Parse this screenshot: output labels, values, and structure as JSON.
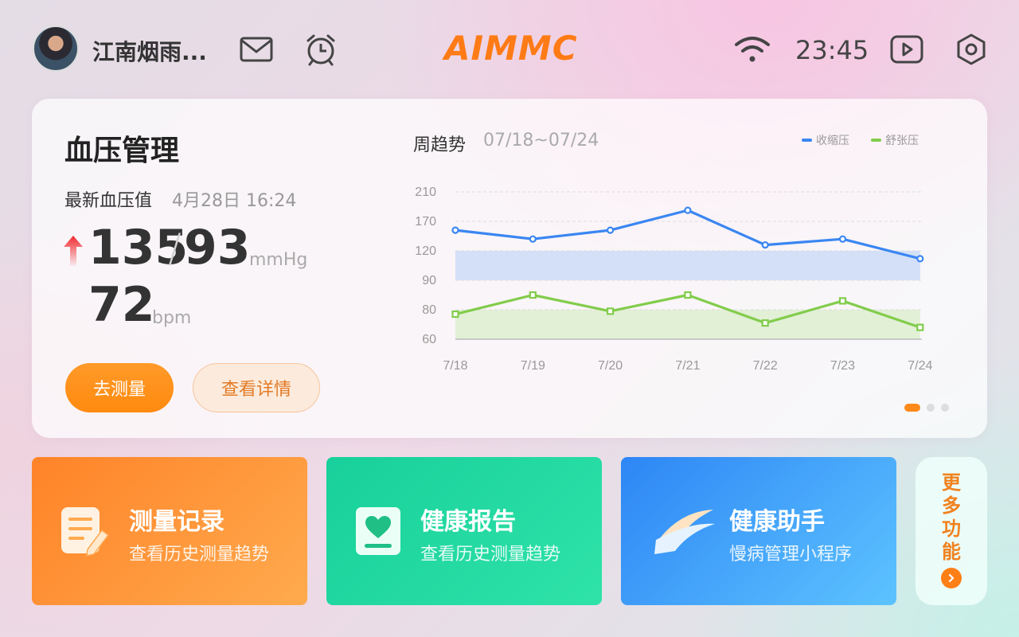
{
  "header": {
    "username": "江南烟雨...",
    "logo": "AIMMC",
    "time": "23:45",
    "icons": [
      "avatar",
      "mail-icon",
      "alarm-icon",
      "wifi-icon",
      "video-icon",
      "settings-icon"
    ]
  },
  "bp_card": {
    "title": "血压管理",
    "latest_label": "最新血压值",
    "latest_time": "4月28日 16:24",
    "systolic": "135",
    "slash": "/",
    "diastolic": "93",
    "bp_unit": "mmHg",
    "pulse": "72",
    "pulse_unit": "bpm",
    "measure_button": "去测量",
    "detail_button": "查看详情",
    "trend_title": "周趋势",
    "trend_range": "07/18~07/24",
    "carousel_pages": 3,
    "carousel_active": 0
  },
  "chart_data": {
    "type": "line",
    "categories": [
      "7/18",
      "7/19",
      "7/20",
      "7/21",
      "7/22",
      "7/23",
      "7/24"
    ],
    "y_ticks": [
      "210",
      "170",
      "120",
      "90",
      "80",
      "60"
    ],
    "series": [
      {
        "name": "收缩压",
        "color": "#3a86f2",
        "values": [
          155,
          140,
          155,
          185,
          130,
          140,
          112
        ]
      },
      {
        "name": "舒张压",
        "color": "#82cc4c",
        "values": [
          77,
          85,
          79,
          85,
          71,
          83,
          68
        ]
      }
    ],
    "bands": [
      {
        "from": 90,
        "to": 120,
        "color": "#d3e0f8"
      },
      {
        "from": 60,
        "to": 80,
        "color": "#e2f0d6"
      }
    ],
    "grid": true,
    "legend": "top-right"
  },
  "tiles": [
    {
      "title": "测量记录",
      "subtitle": "查看历史测量趋势"
    },
    {
      "title": "健康报告",
      "subtitle": "查看历史测量趋势"
    },
    {
      "title": "健康助手",
      "subtitle": "慢病管理小程序"
    }
  ],
  "more": {
    "label": "更多功能"
  }
}
